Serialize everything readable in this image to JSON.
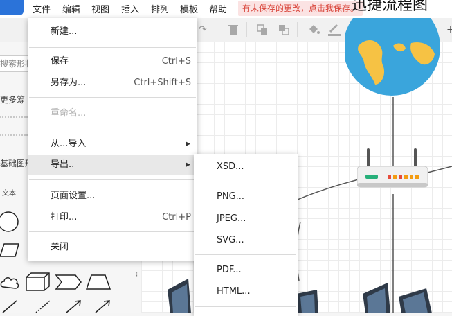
{
  "menubar": {
    "items": [
      "文件",
      "编辑",
      "视图",
      "插入",
      "排列",
      "模板",
      "帮助"
    ],
    "unsaved_notice": "有未保存的更改，点击我保存。",
    "doc_title": "迅捷流程图"
  },
  "toolbar": {
    "icons": [
      "redo-icon",
      "delete-icon",
      "to-front-icon",
      "to-back-icon",
      "fill-color-icon",
      "line-color-icon",
      "shadow-icon",
      "connection-style-icon",
      "waypoint-style-icon"
    ]
  },
  "sidebar": {
    "search_placeholder": "搜索形状",
    "more_shapes": "更多筹",
    "basic_shapes": "基础图形",
    "text_shape": "文本"
  },
  "file_menu": {
    "new": "新建...",
    "save": "保存",
    "save_shortcut": "Ctrl+S",
    "save_as": "另存为...",
    "save_as_shortcut": "Ctrl+Shift+S",
    "rename": "重命名...",
    "import_from": "从...导入",
    "export": "导出..",
    "page_setup": "页面设置...",
    "print": "打印...",
    "print_shortcut": "Ctrl+P",
    "close": "关闭"
  },
  "export_menu": {
    "xsd": "XSD...",
    "png": "PNG...",
    "jpeg": "JPEG...",
    "svg": "SVG...",
    "pdf": "PDF...",
    "html": "HTML..."
  },
  "colors": {
    "accent": "#2b73d9",
    "unsaved_bg": "#fbe3e3",
    "unsaved_text": "#d9453b",
    "globe_ocean": "#3aa5dc",
    "globe_land": "#f6c244"
  }
}
